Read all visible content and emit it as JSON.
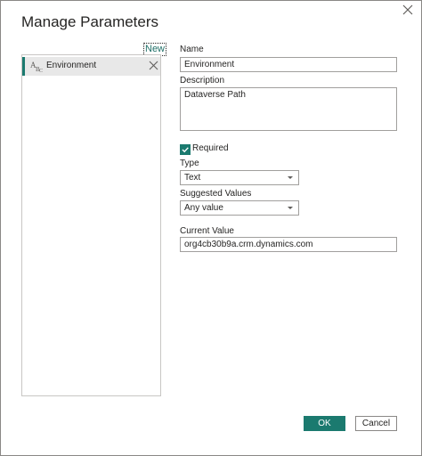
{
  "dialog": {
    "title": "Manage Parameters",
    "close_icon": "close-icon"
  },
  "sidebar": {
    "new_label": "New",
    "items": [
      {
        "label": "Environment",
        "type_icon": "text-type-icon",
        "delete_icon": "close-icon",
        "selected": true
      }
    ]
  },
  "form": {
    "name_label": "Name",
    "name_value": "Environment",
    "description_label": "Description",
    "description_value": "Dataverse Path",
    "required_label": "Required",
    "required_checked": true,
    "type_label": "Type",
    "type_value": "Text",
    "suggested_values_label": "Suggested Values",
    "suggested_values_value": "Any value",
    "current_value_label": "Current Value",
    "current_value": "org4cb30b9a.crm.dynamics.com"
  },
  "footer": {
    "ok_label": "OK",
    "cancel_label": "Cancel"
  },
  "colors": {
    "accent": "#1b7a6f",
    "selected_item_bg": "#e8e8e8",
    "border": "#a19f9d"
  }
}
